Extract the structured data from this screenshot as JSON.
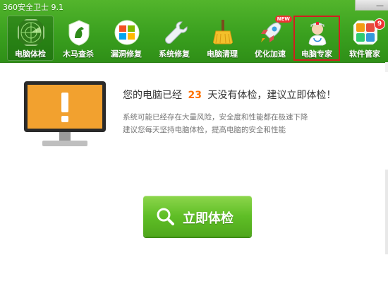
{
  "window": {
    "title": "360安全卫士 9.1"
  },
  "nav": {
    "items": [
      {
        "label": "电脑体检",
        "icon": "radar-icon",
        "active": true
      },
      {
        "label": "木马查杀",
        "icon": "trojan-horse-icon"
      },
      {
        "label": "漏洞修复",
        "icon": "windows-patch-icon"
      },
      {
        "label": "系统修复",
        "icon": "wrench-icon"
      },
      {
        "label": "电脑清理",
        "icon": "broom-icon"
      },
      {
        "label": "优化加速",
        "icon": "rocket-icon",
        "badge": "NEW"
      },
      {
        "label": "电脑专家",
        "icon": "doctor-icon",
        "highlighted": true
      },
      {
        "label": "软件管家",
        "icon": "app-grid-icon",
        "badge": "9"
      }
    ]
  },
  "main": {
    "headline_prefix": "您的电脑已经",
    "days": "23",
    "headline_suffix": "天没有体检，建议立即体检！",
    "desc_line1": "系统可能已经存在大量风险，安全度和性能都在极速下降",
    "desc_line2": "建议您每天坚持电脑体检，提高电脑的安全和性能",
    "check_button": "立即体检"
  },
  "colors": {
    "brand_green": "#3aa01f",
    "accent_orange": "#ff7200",
    "highlight_red": "#d11f1f"
  }
}
